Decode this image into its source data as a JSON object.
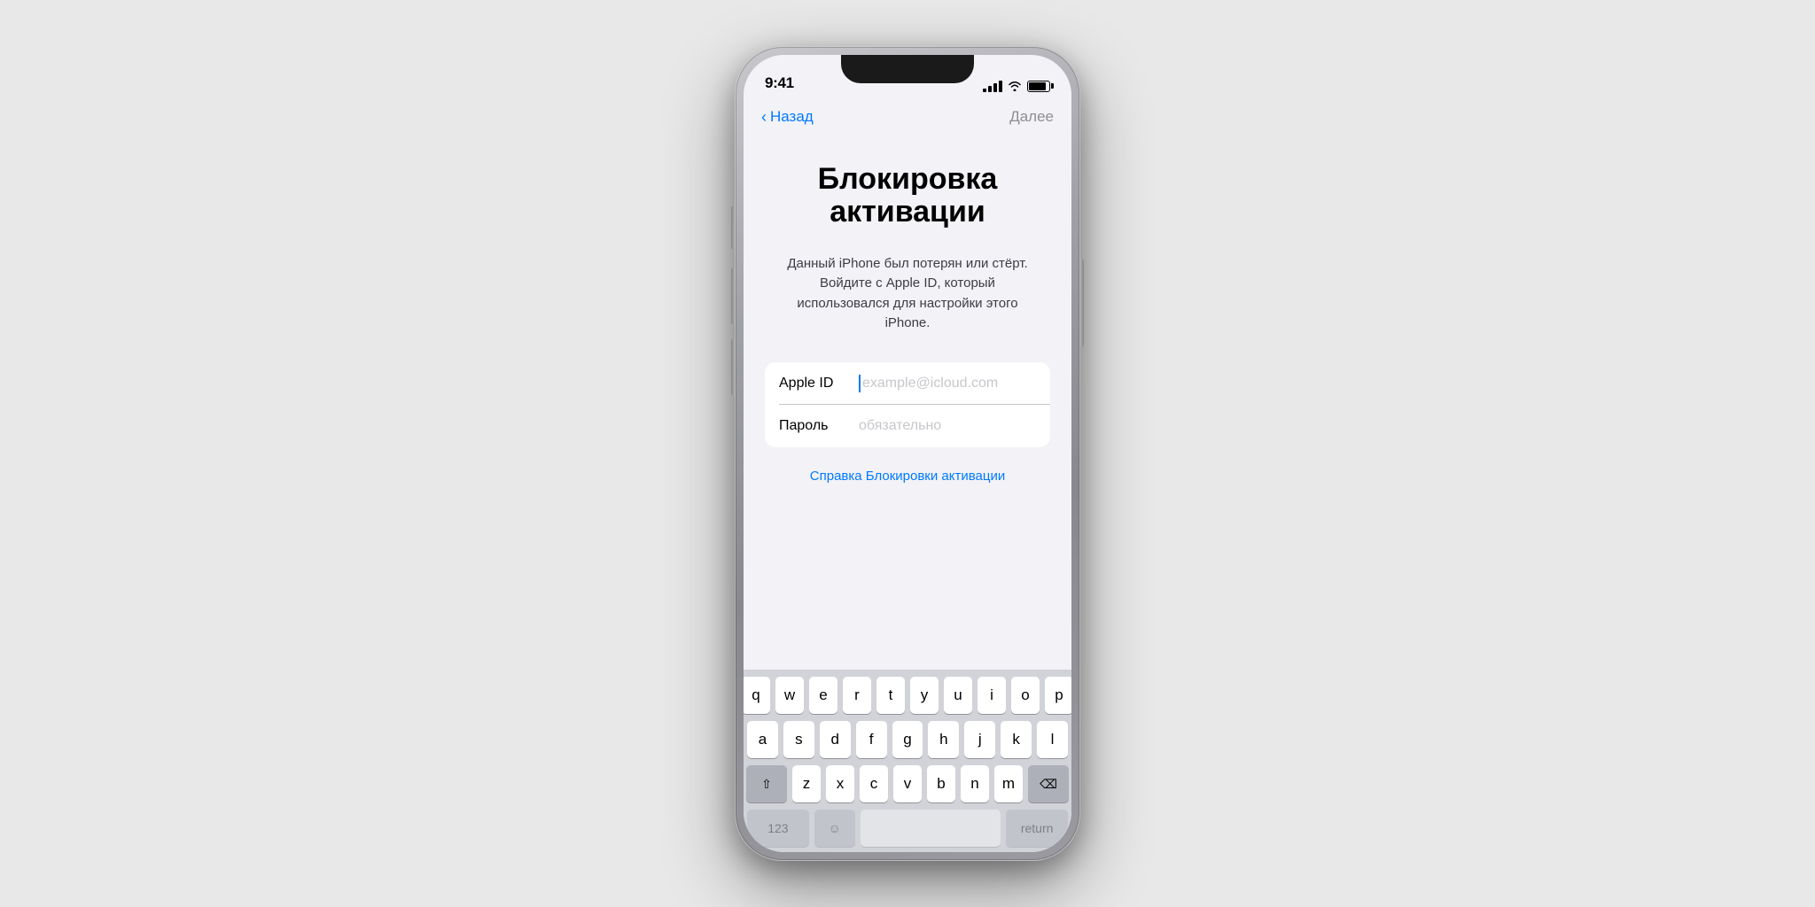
{
  "background_color": "#e8e8e8",
  "phone": {
    "status_bar": {
      "time": "9:41",
      "signal_label": "signal",
      "wifi_label": "wifi",
      "battery_label": "battery"
    },
    "nav": {
      "back_label": "Назад",
      "next_label": "Далее"
    },
    "page": {
      "title": "Блокировка активации",
      "description": "Данный iPhone был потерян или стёрт. Войдите с Apple ID, который использовался для настройки этого iPhone.",
      "apple_id_label": "Apple ID",
      "apple_id_placeholder": "example@icloud.com",
      "password_label": "Пароль",
      "password_placeholder": "обязательно",
      "help_link": "Справка Блокировки активации"
    },
    "keyboard": {
      "row1": [
        "q",
        "w",
        "e",
        "r",
        "t",
        "y",
        "u",
        "i",
        "o",
        "p"
      ],
      "row2": [
        "a",
        "s",
        "d",
        "f",
        "g",
        "h",
        "j",
        "k",
        "l"
      ],
      "row3_label": "keyboard-row-3",
      "row3": [
        "z",
        "x",
        "c",
        "v",
        "b",
        "n",
        "m"
      ]
    }
  }
}
